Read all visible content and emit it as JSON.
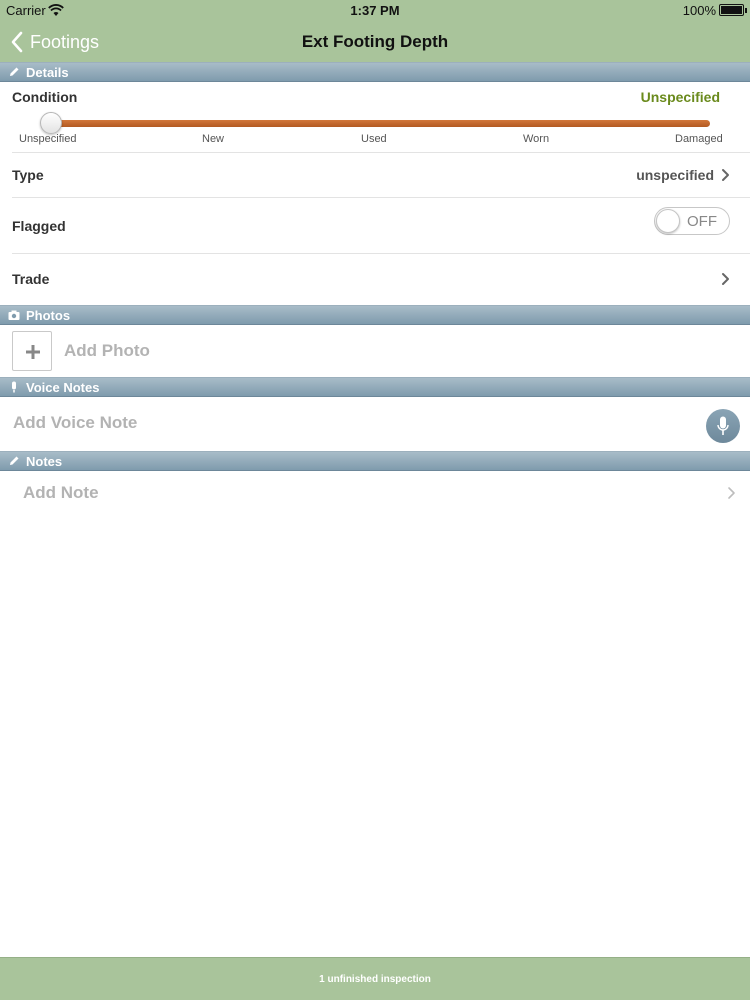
{
  "status_bar": {
    "carrier": "Carrier",
    "time": "1:37 PM",
    "battery": "100%"
  },
  "nav": {
    "back_label": "Footings",
    "title": "Ext Footing Depth"
  },
  "sections": {
    "details": "Details",
    "photos": "Photos",
    "voice_notes": "Voice Notes",
    "notes": "Notes"
  },
  "condition": {
    "label": "Condition",
    "value": "Unspecified",
    "value_color": "#6a8a1c",
    "ticks": [
      "Unspecified",
      "New",
      "Used",
      "Worn",
      "Damaged"
    ],
    "selected_index": 0
  },
  "type": {
    "label": "Type",
    "value": "unspecified"
  },
  "flagged": {
    "label": "Flagged",
    "state": "OFF"
  },
  "trade": {
    "label": "Trade"
  },
  "photos": {
    "add_label": "Add Photo"
  },
  "voice_notes": {
    "add_label": "Add Voice Note"
  },
  "notes": {
    "add_label": "Add Note"
  },
  "footer": {
    "text": "1 unfinished inspection"
  },
  "colors": {
    "bar_green": "#a9c49b",
    "section_blue": "#7f9bad",
    "slider_orange": "#c2672c"
  }
}
